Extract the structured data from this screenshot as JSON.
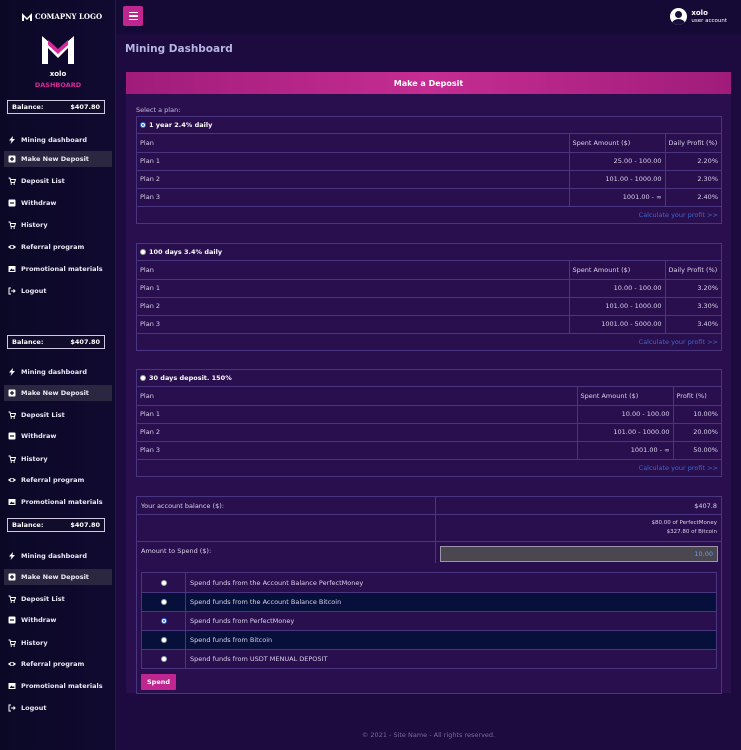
{
  "company": "COMAPNY LOGO",
  "sidebar": {
    "username": "xolo",
    "dashboard_label": "DASHBOARD",
    "balance_label": "Balance:",
    "balance_value": "$407.80",
    "items": [
      {
        "label": "Mining dashboard",
        "icon": "bolt-icon"
      },
      {
        "label": "Make New Deposit",
        "icon": "plus-square-icon"
      },
      {
        "label": "Deposit List",
        "icon": "cart-icon"
      },
      {
        "label": "Withdraw",
        "icon": "minus-square-icon"
      },
      {
        "label": "History",
        "icon": "cart-icon"
      },
      {
        "label": "Referral program",
        "icon": "eye-icon"
      },
      {
        "label": "Promotional materials",
        "icon": "image-icon"
      },
      {
        "label": "Logout",
        "icon": "logout-icon"
      }
    ]
  },
  "topbar": {
    "username": "xolo",
    "role": "user account"
  },
  "page_title": "Mining Dashboard",
  "deposit": {
    "header": "Make a Deposit",
    "select_plan": "Select a plan:",
    "calc_link": "Calculate your profit >>",
    "plan_groups": [
      {
        "title": "1 year 2.4% daily",
        "selected": true,
        "headers": [
          "Plan",
          "Spent Amount ($)",
          "Daily Profit (%)"
        ],
        "rows": [
          [
            "Plan 1",
            "25.00 - 100.00",
            "2.20%"
          ],
          [
            "Plan 2",
            "101.00 - 1000.00",
            "2.30%"
          ],
          [
            "Plan 3",
            "1001.00 - ∞",
            "2.40%"
          ]
        ]
      },
      {
        "title": "100 days 3.4% daily",
        "selected": false,
        "headers": [
          "Plan",
          "Spent Amount ($)",
          "Daily Profit (%)"
        ],
        "rows": [
          [
            "Plan 1",
            "10.00 - 100.00",
            "3.20%"
          ],
          [
            "Plan 2",
            "101.00 - 1000.00",
            "3.30%"
          ],
          [
            "Plan 3",
            "1001.00 - 5000.00",
            "3.40%"
          ]
        ]
      },
      {
        "title": "30 days deposit. 150%",
        "selected": false,
        "headers": [
          "Plan",
          "Spent Amount ($)",
          "Profit (%)"
        ],
        "rows": [
          [
            "Plan 1",
            "10.00 - 100.00",
            "10.00%"
          ],
          [
            "Plan 2",
            "101.00 - 1000.00",
            "20.00%"
          ],
          [
            "Plan 3",
            "1001.00 - ∞",
            "50.00%"
          ]
        ]
      }
    ],
    "account_balance_label": "Your account balance ($):",
    "account_balance_value": "$407.8",
    "perfectmoney_balance": "$80.00 of PerfectMoney",
    "bitcoin_balance": "$327.80 of Bitcoin",
    "amount_label": "Amount to Spend ($):",
    "amount_value": "10.00",
    "options": [
      {
        "label": "Spend funds from the Account Balance PerfectMoney",
        "selected": false
      },
      {
        "label": "Spend funds from the Account Balance Bitcoin",
        "selected": false
      },
      {
        "label": "Spend funds from PerfectMoney",
        "selected": true
      },
      {
        "label": "Spend funds from Bitcoin",
        "selected": false
      },
      {
        "label": "Spend funds from USDT MENUAL DEPOSIT",
        "selected": false
      }
    ],
    "spend_button": "Spend"
  },
  "footer": "© 2021 - Site Name - All rights reserved."
}
